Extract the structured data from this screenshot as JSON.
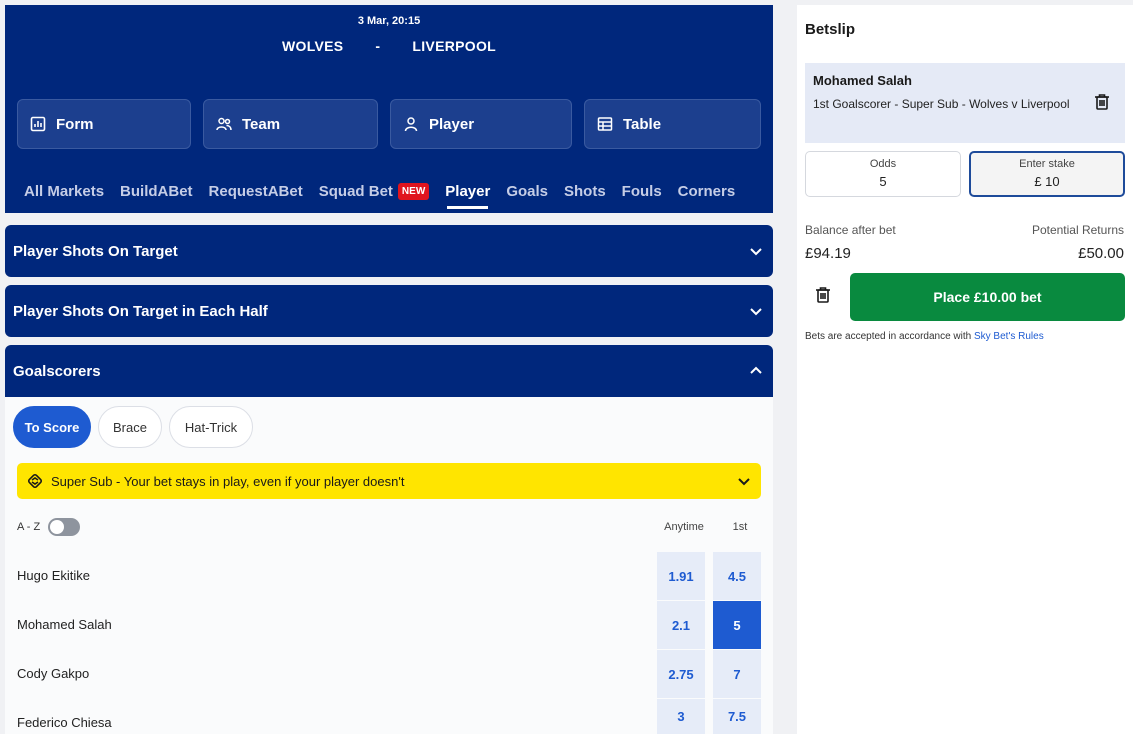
{
  "match": {
    "datetime": "3 Mar, 20:15",
    "home": "WOLVES",
    "separator": "-",
    "away": "LIVERPOOL"
  },
  "nav_buttons": [
    {
      "label": "Form",
      "icon": "bar-chart-icon"
    },
    {
      "label": "Team",
      "icon": "team-icon"
    },
    {
      "label": "Player",
      "icon": "person-icon"
    },
    {
      "label": "Table",
      "icon": "table-icon"
    }
  ],
  "tabs": [
    {
      "label": "All Markets"
    },
    {
      "label": "BuildABet"
    },
    {
      "label": "RequestABet"
    },
    {
      "label": "Squad Bet",
      "badge": "NEW"
    },
    {
      "label": "Player",
      "active": true
    },
    {
      "label": "Goals"
    },
    {
      "label": "Shots"
    },
    {
      "label": "Fouls"
    },
    {
      "label": "Corners"
    }
  ],
  "markets": [
    {
      "title": "Player Shots On Target",
      "open": false
    },
    {
      "title": "Player Shots On Target in Each Half",
      "open": false
    },
    {
      "title": "Goalscorers",
      "open": true
    }
  ],
  "goalscorer_pills": [
    {
      "label": "To Score",
      "active": true
    },
    {
      "label": "Brace"
    },
    {
      "label": "Hat-Trick"
    }
  ],
  "super_sub": {
    "text": "Super Sub - Your bet stays in play, even if your player doesn't"
  },
  "sort": {
    "label": "A - Z"
  },
  "columns": {
    "anytime": "Anytime",
    "first": "1st"
  },
  "players": [
    {
      "name": "Hugo Ekitike",
      "anytime": "1.91",
      "first": "4.5"
    },
    {
      "name": "Mohamed Salah",
      "anytime": "2.1",
      "first": "5",
      "first_selected": true
    },
    {
      "name": "Cody Gakpo",
      "anytime": "2.75",
      "first": "7"
    },
    {
      "name": "Federico Chiesa",
      "anytime": "3",
      "first": "7.5"
    }
  ],
  "betslip": {
    "title": "Betslip",
    "selection_name": "Mohamed Salah",
    "selection_desc": "1st Goalscorer - Super Sub - Wolves v Liverpool",
    "odds_label": "Odds",
    "odds_value": "5",
    "stake_label": "Enter stake",
    "stake_value": "£ 10",
    "balance_label": "Balance after bet",
    "balance_value": "£94.19",
    "returns_label": "Potential Returns",
    "returns_value": "£50.00",
    "place_label": "Place £10.00 bet",
    "rules_text": "Bets are accepted in accordance with ",
    "rules_link": "Sky Bet's Rules"
  },
  "colors": {
    "navy": "#00277c",
    "blue": "#1e5bd1",
    "yellow": "#ffe500",
    "green": "#098a3f",
    "red_badge": "#e0141e"
  }
}
